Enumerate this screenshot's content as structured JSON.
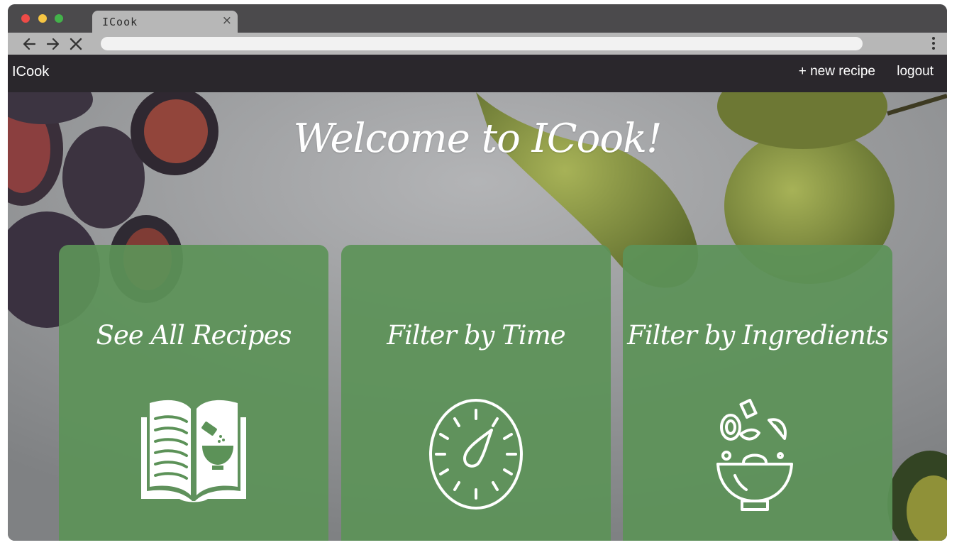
{
  "browser": {
    "tab_title": "ICook",
    "tab_close": "×",
    "address": ""
  },
  "navbar": {
    "brand": "ICook",
    "new_recipe": "+ new recipe",
    "logout": "logout"
  },
  "hero": {
    "title": "Welcome to ICook!"
  },
  "cards": [
    {
      "title": "See All Recipes",
      "icon": "recipe-book-icon"
    },
    {
      "title": "Filter by Time",
      "icon": "timer-icon"
    },
    {
      "title": "Filter by Ingredients",
      "icon": "salad-bowl-icon"
    }
  ],
  "colors": {
    "navbar_bg": "#2a272c",
    "card_green": "#5c9258",
    "browser_chrome": "#4b4a4c",
    "tab_bg": "#b7b7b7"
  }
}
